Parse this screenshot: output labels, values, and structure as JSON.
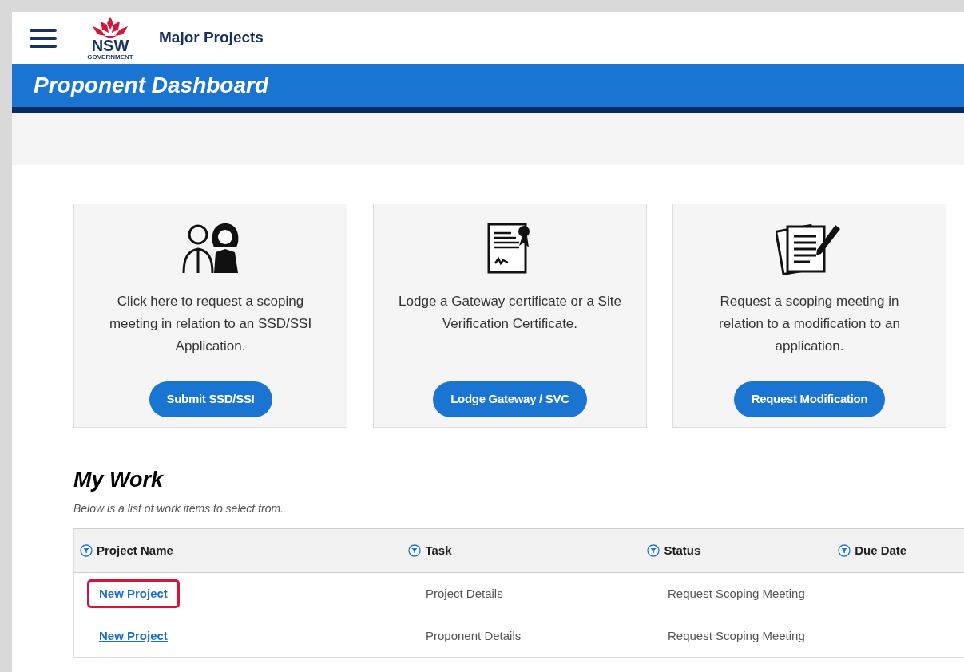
{
  "header": {
    "logo_text": "NSW",
    "logo_subtext": "GOVERNMENT",
    "site_title": "Major Projects"
  },
  "banner": {
    "title": "Proponent Dashboard"
  },
  "cards": [
    {
      "kind": "people",
      "description": "Click here to request a scoping meeting in relation to an SSD/SSI Application.",
      "button": "Submit SSD/SSI"
    },
    {
      "kind": "certificate",
      "description": "Lodge a Gateway certificate or a Site Verification Certificate.",
      "button": "Lodge Gateway / SVC"
    },
    {
      "kind": "document",
      "description": "Request a scoping meeting in relation to a modification to an application.",
      "button": "Request Modification"
    }
  ],
  "my_work": {
    "title": "My Work",
    "subtitle": "Below is a list of work items to select from.",
    "table": {
      "columns": [
        "Project Name",
        "Task",
        "Status",
        "Due Date"
      ],
      "rows": [
        {
          "project_name": "New Project",
          "task": "Project Details",
          "status": "Request Scoping Meeting",
          "highlighted": true
        },
        {
          "project_name": "New Project",
          "task": "Proponent Details",
          "status": "Request Scoping Meeting",
          "highlighted": false
        }
      ]
    }
  }
}
